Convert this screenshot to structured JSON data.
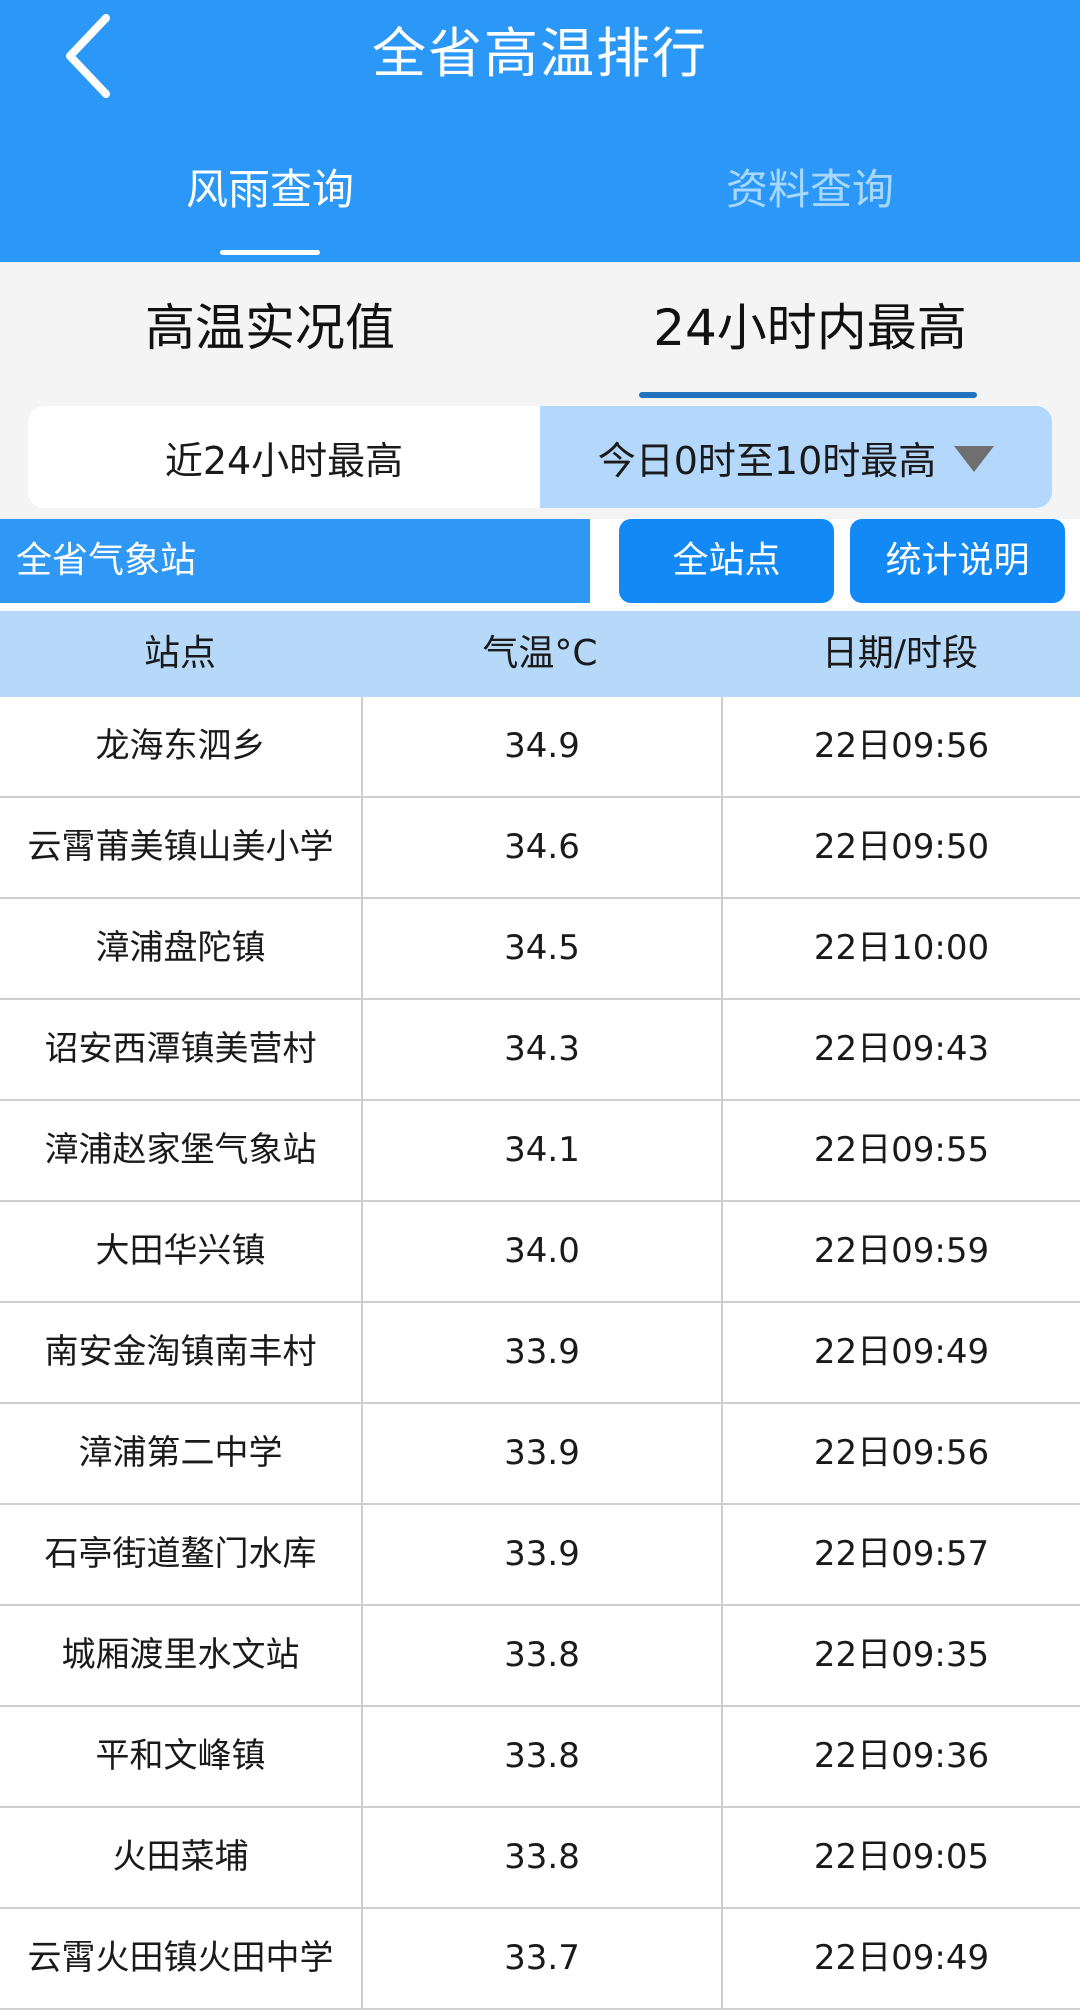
{
  "header": {
    "back_icon": "chevron-left-icon",
    "title": "全省高温排行",
    "tabs": [
      {
        "label": "风雨查询",
        "active": true
      },
      {
        "label": "资料查询",
        "active": false
      }
    ]
  },
  "subtabs": [
    {
      "label": "高温实况值",
      "active": false
    },
    {
      "label": "24小时内最高",
      "active": true
    }
  ],
  "range_toggle": {
    "left_label": "近24小时最高",
    "right_label": "今日0时至10时最高",
    "dropdown_icon": "triangle-down-icon"
  },
  "filter": {
    "region_label": "全省气象站",
    "all_stations_button": "全站点",
    "explain_button": "统计说明"
  },
  "table": {
    "headers": [
      "站点",
      "气温°C",
      "日期/时段"
    ],
    "rows": [
      {
        "station": "龙海东泗乡",
        "temp": "34.9",
        "time": "22日09:56"
      },
      {
        "station": "云霄莆美镇山美小学",
        "temp": "34.6",
        "time": "22日09:50"
      },
      {
        "station": "漳浦盘陀镇",
        "temp": "34.5",
        "time": "22日10:00"
      },
      {
        "station": "诏安西潭镇美营村",
        "temp": "34.3",
        "time": "22日09:43"
      },
      {
        "station": "漳浦赵家堡气象站",
        "temp": "34.1",
        "time": "22日09:55"
      },
      {
        "station": "大田华兴镇",
        "temp": "34.0",
        "time": "22日09:59"
      },
      {
        "station": "南安金淘镇南丰村",
        "temp": "33.9",
        "time": "22日09:49"
      },
      {
        "station": "漳浦第二中学",
        "temp": "33.9",
        "time": "22日09:56"
      },
      {
        "station": "石亭街道鳌门水库",
        "temp": "33.9",
        "time": "22日09:57"
      },
      {
        "station": "城厢渡里水文站",
        "temp": "33.8",
        "time": "22日09:35"
      },
      {
        "station": "平和文峰镇",
        "temp": "33.8",
        "time": "22日09:36"
      },
      {
        "station": "火田菜埔",
        "temp": "33.8",
        "time": "22日09:05"
      },
      {
        "station": "云霄火田镇火田中学",
        "temp": "33.7",
        "time": "22日09:49"
      }
    ]
  },
  "colors": {
    "header_blue": "#2b97f7",
    "button_blue": "#1289f5",
    "light_blue": "#b6d9fa",
    "active_underline": "#2273bf"
  }
}
